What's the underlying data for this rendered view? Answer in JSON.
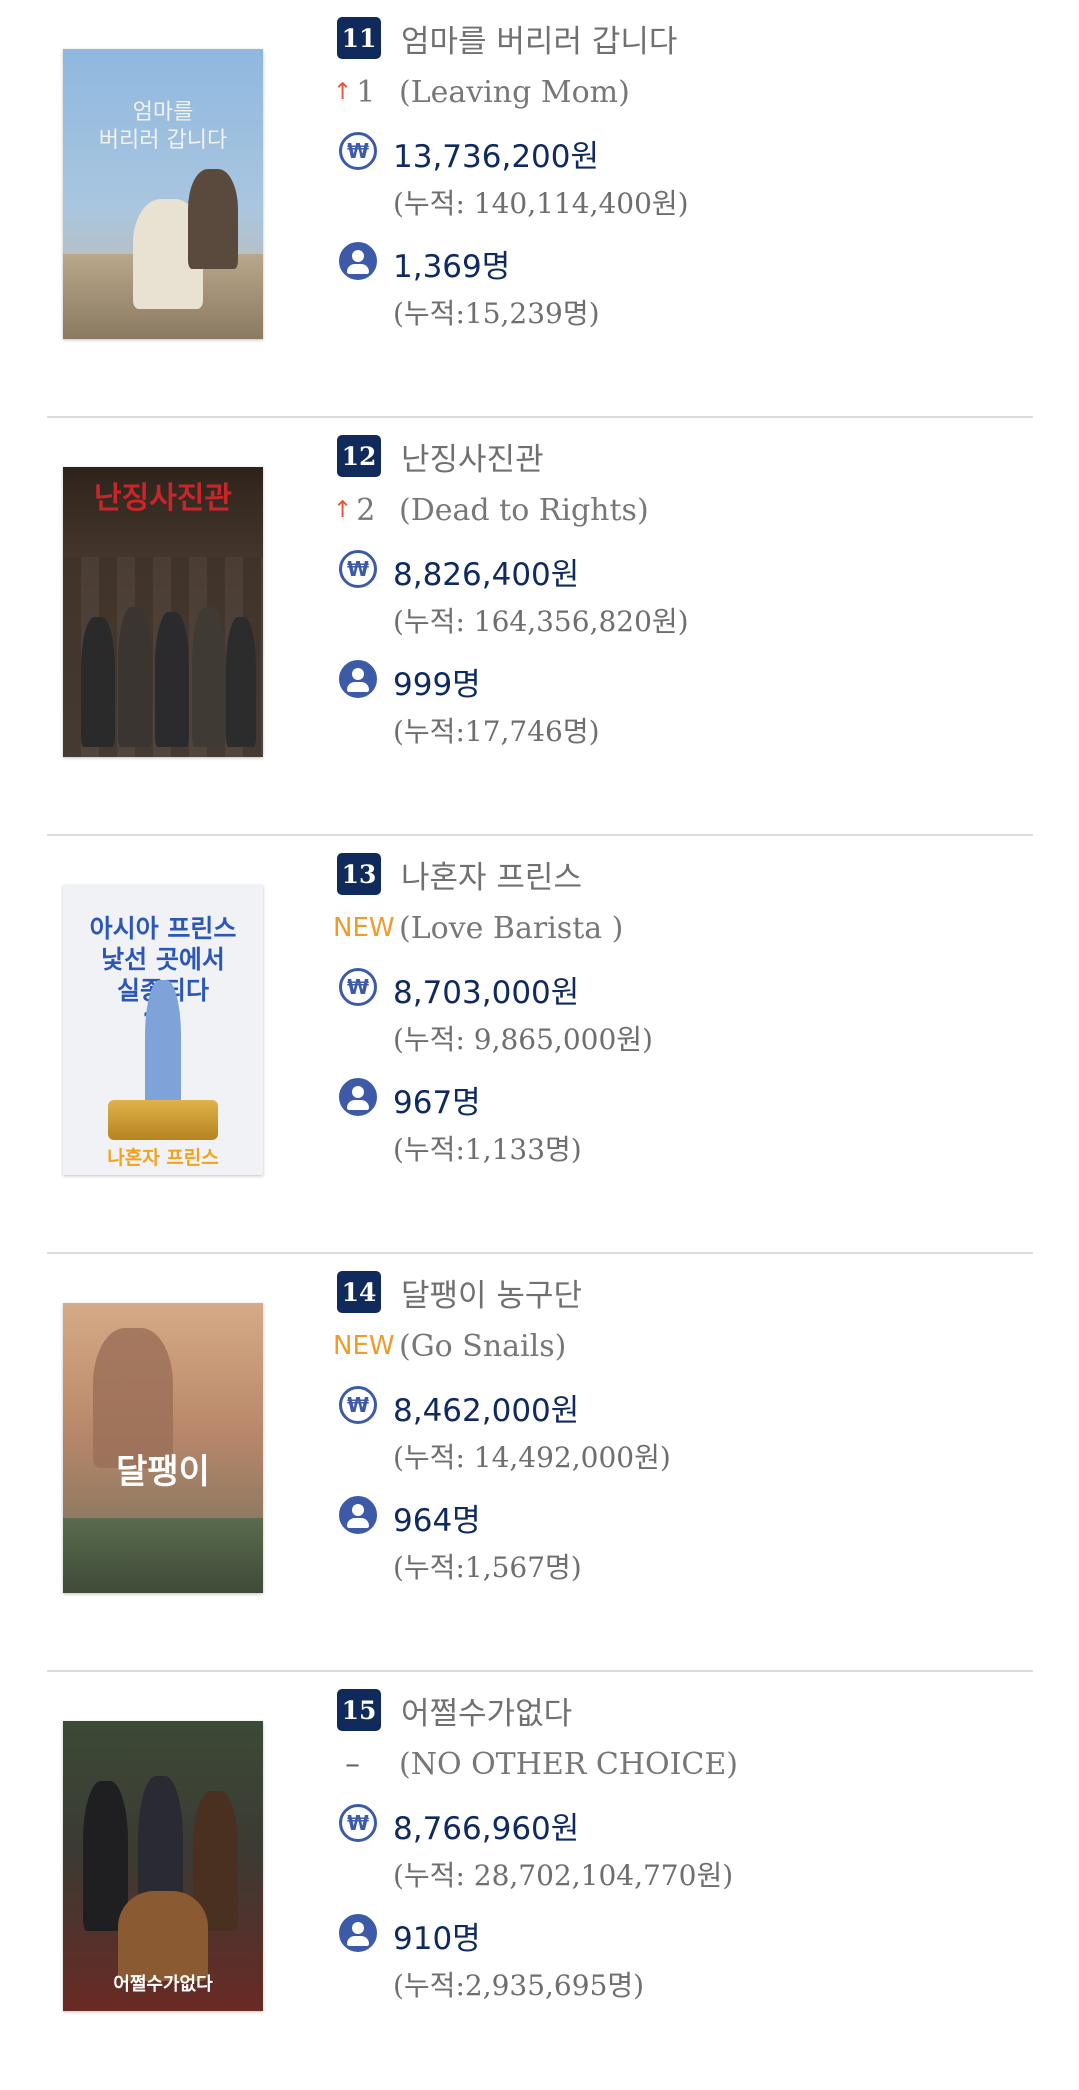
{
  "movies": [
    {
      "rank": "11",
      "title_ko": "엄마를 버리러 갑니다",
      "change_arrow": "↑",
      "change_value": "1",
      "change_type": "up",
      "title_en": "(Leaving Mom)",
      "daily_sales": "13,736,200원",
      "cum_sales": "(누적: 140,114,400원)",
      "daily_audience": "1,369명",
      "cum_audience": "(누적:15,239명)",
      "poster": {
        "title_text": "엄마를\n버리러 갑니다",
        "bg_top": "#8fb8df",
        "bg_bottom": "#c9b79a",
        "accent": "#f4f1e8"
      }
    },
    {
      "rank": "12",
      "title_ko": "난징사진관",
      "change_arrow": "↑",
      "change_value": "2",
      "change_type": "up",
      "title_en": "(Dead to Rights)",
      "daily_sales": "8,826,400원",
      "cum_sales": "(누적: 164,356,820원)",
      "daily_audience": "999명",
      "cum_audience": "(누적:17,746명)",
      "poster": {
        "title_text": "난징사진관",
        "bg_top": "#3a2a22",
        "bg_bottom": "#4b4a46",
        "accent": "#c8262a"
      }
    },
    {
      "rank": "13",
      "title_ko": "나혼자 프린스",
      "change_arrow": "",
      "change_value": "NEW",
      "change_type": "new",
      "title_en": "(Love Barista )",
      "daily_sales": "8,703,000원",
      "cum_sales": "(누적: 9,865,000원)",
      "daily_audience": "967명",
      "cum_audience": "(누적:1,133명)",
      "poster": {
        "title_text": "아시아 프린스\n낯선 곳에서\n실종되다\n??!",
        "bg_top": "#f3f4f8",
        "bg_bottom": "#eef0f5",
        "accent": "#2a57b8"
      }
    },
    {
      "rank": "14",
      "title_ko": "달팽이 농구단",
      "change_arrow": "",
      "change_value": "NEW",
      "change_type": "new",
      "title_en": "(Go Snails)",
      "daily_sales": "8,462,000원",
      "cum_sales": "(누적: 14,492,000원)",
      "daily_audience": "964명",
      "cum_audience": "(누적:1,567명)",
      "poster": {
        "title_text": "달팽이",
        "bg_top": "#cfa07a",
        "bg_bottom": "#5f6b56",
        "accent": "#ffffff"
      }
    },
    {
      "rank": "15",
      "title_ko": "어쩔수가없다",
      "change_arrow": "",
      "change_value": "–",
      "change_type": "same",
      "title_en": "(NO OTHER CHOICE)",
      "daily_sales": "8,766,960원",
      "cum_sales": "(누적: 28,702,104,770원)",
      "daily_audience": "910명",
      "cum_audience": "(누적:2,935,695명)",
      "poster": {
        "title_text": "어쩔수가없다",
        "bg_top": "#3c4a36",
        "bg_bottom": "#6a2a24",
        "accent": "#ffffff"
      }
    }
  ]
}
